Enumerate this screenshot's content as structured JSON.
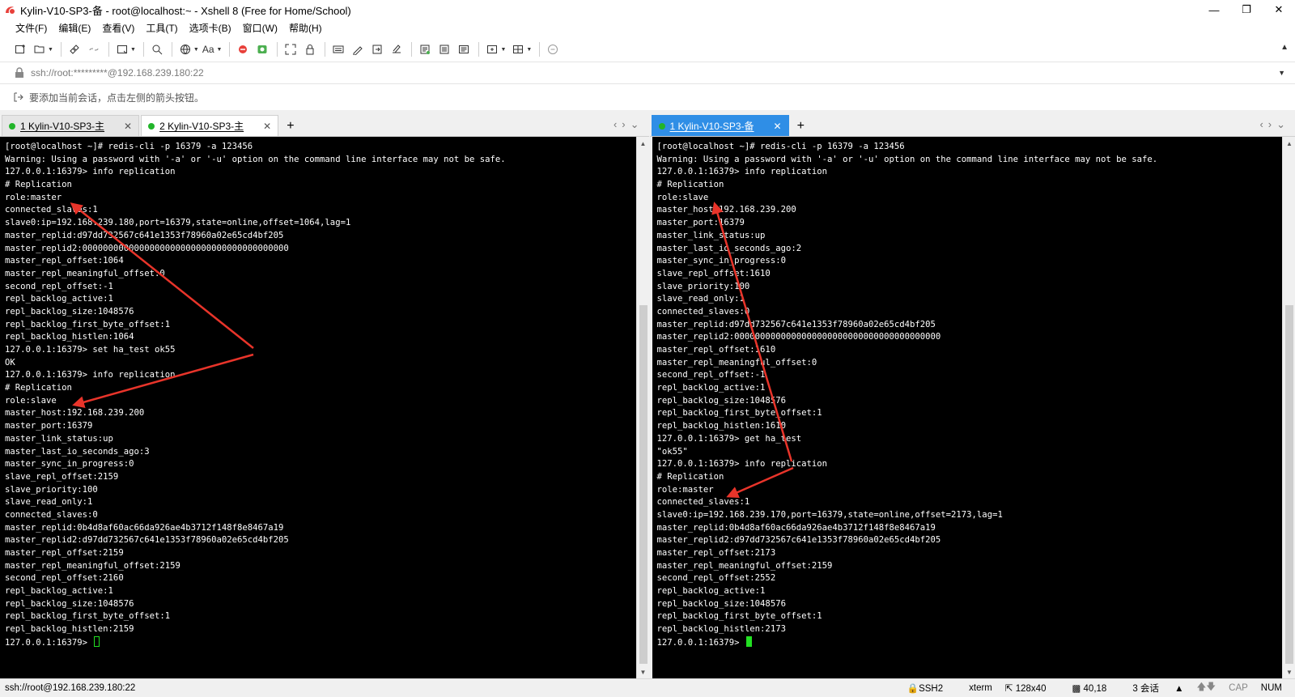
{
  "window": {
    "title": "Kylin-V10-SP3-备 - root@localhost:~ - Xshell 8 (Free for Home/School)"
  },
  "menu": [
    "文件(F)",
    "编辑(E)",
    "查看(V)",
    "工具(T)",
    "选项卡(B)",
    "窗口(W)",
    "帮助(H)"
  ],
  "toolbar": {
    "font_label": "Aa"
  },
  "address": {
    "value": "ssh://root:*********@192.168.239.180:22"
  },
  "hint": "要添加当前会话，点击左侧的箭头按钮。",
  "left_pane": {
    "tabs": [
      {
        "label": "1 Kylin-V10-SP3-主",
        "close": "✕"
      },
      {
        "label": "2 Kylin-V10-SP3-主",
        "close": "✕"
      }
    ],
    "add": "+",
    "lines": [
      "[root@localhost ~]# redis-cli -p 16379 -a 123456",
      "Warning: Using a password with '-a' or '-u' option on the command line interface may not be safe.",
      "127.0.0.1:16379> info replication",
      "# Replication",
      "role:master",
      "connected_slaves:1",
      "slave0:ip=192.168.239.180,port=16379,state=online,offset=1064,lag=1",
      "master_replid:d97dd732567c641e1353f78960a02e65cd4bf205",
      "master_replid2:0000000000000000000000000000000000000000",
      "master_repl_offset:1064",
      "master_repl_meaningful_offset:0",
      "second_repl_offset:-1",
      "repl_backlog_active:1",
      "repl_backlog_size:1048576",
      "repl_backlog_first_byte_offset:1",
      "repl_backlog_histlen:1064",
      "127.0.0.1:16379> set ha_test ok55",
      "OK",
      "127.0.0.1:16379> info replication",
      "# Replication",
      "role:slave",
      "master_host:192.168.239.200",
      "master_port:16379",
      "master_link_status:up",
      "master_last_io_seconds_ago:3",
      "master_sync_in_progress:0",
      "slave_repl_offset:2159",
      "slave_priority:100",
      "slave_read_only:1",
      "connected_slaves:0",
      "master_replid:0b4d8af60ac66da926ae4b3712f148f8e8467a19",
      "master_replid2:d97dd732567c641e1353f78960a02e65cd4bf205",
      "master_repl_offset:2159",
      "master_repl_meaningful_offset:2159",
      "second_repl_offset:2160",
      "repl_backlog_active:1",
      "repl_backlog_size:1048576",
      "repl_backlog_first_byte_offset:1",
      "repl_backlog_histlen:2159",
      "127.0.0.1:16379> "
    ]
  },
  "right_pane": {
    "tabs": [
      {
        "label": "1 Kylin-V10-SP3-备",
        "close": "✕"
      }
    ],
    "add": "+",
    "lines": [
      "[root@localhost ~]# redis-cli -p 16379 -a 123456",
      "Warning: Using a password with '-a' or '-u' option on the command line interface may not be safe.",
      "127.0.0.1:16379> info replication",
      "# Replication",
      "role:slave",
      "master_host:192.168.239.200",
      "master_port:16379",
      "master_link_status:up",
      "master_last_io_seconds_ago:2",
      "master_sync_in_progress:0",
      "slave_repl_offset:1610",
      "slave_priority:100",
      "slave_read_only:1",
      "connected_slaves:0",
      "master_replid:d97dd732567c641e1353f78960a02e65cd4bf205",
      "master_replid2:0000000000000000000000000000000000000000",
      "master_repl_offset:1610",
      "master_repl_meaningful_offset:0",
      "second_repl_offset:-1",
      "repl_backlog_active:1",
      "repl_backlog_size:1048576",
      "repl_backlog_first_byte_offset:1",
      "repl_backlog_histlen:1610",
      "127.0.0.1:16379> get ha_test",
      "\"ok55\"",
      "127.0.0.1:16379> info replication",
      "# Replication",
      "role:master",
      "connected_slaves:1",
      "slave0:ip=192.168.239.170,port=16379,state=online,offset=2173,lag=1",
      "master_replid:0b4d8af60ac66da926ae4b3712f148f8e8467a19",
      "master_replid2:d97dd732567c641e1353f78960a02e65cd4bf205",
      "master_repl_offset:2173",
      "master_repl_meaningful_offset:2159",
      "second_repl_offset:2552",
      "repl_backlog_active:1",
      "repl_backlog_size:1048576",
      "repl_backlog_first_byte_offset:1",
      "repl_backlog_histlen:2173",
      "127.0.0.1:16379> "
    ]
  },
  "status": {
    "connection": "ssh://root@192.168.239.180:22",
    "protocol": "SSH2",
    "terminal": "xterm",
    "size": "128x40",
    "cursor": "40,18",
    "sessions": "3 会话",
    "cap": "CAP",
    "num": "NUM"
  },
  "colors": {
    "annotation_arrow": "#e8342a",
    "cursor": "#22e022",
    "active_tab": "#2f8ee6",
    "connected_dot": "#22b52a"
  }
}
